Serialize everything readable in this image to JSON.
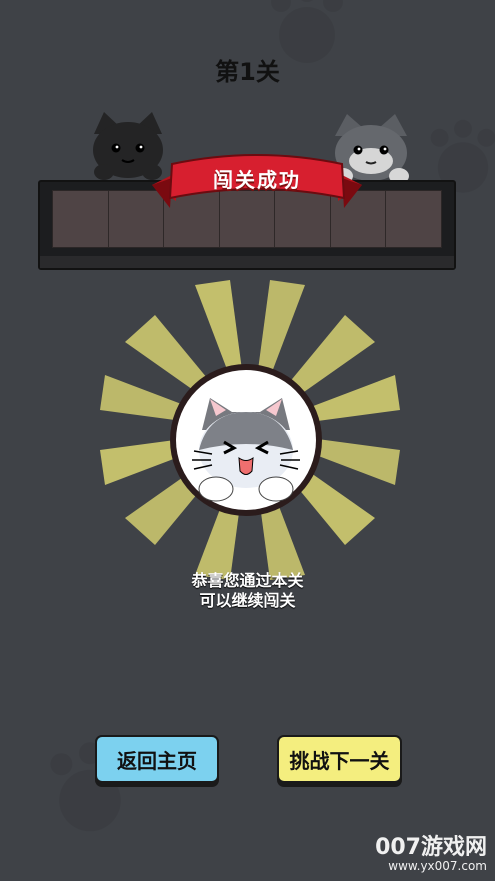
{
  "level": {
    "title": "第1关"
  },
  "banner": {
    "text": "闯关成功"
  },
  "message": {
    "line1": "恭喜您通过本关",
    "line2": "可以继续闯关"
  },
  "buttons": {
    "home": "返回主页",
    "next": "挑战下一关"
  },
  "watermark": {
    "main": "007游戏网",
    "url": "www.yx007.com"
  },
  "icons": {
    "top_left": "black-cat-icon",
    "top_right": "gray-cat-icon",
    "center": "happy-cat-icon",
    "banner": "ribbon-banner-icon"
  },
  "colors": {
    "background": "#3f4247",
    "home_button": "#7cd1ef",
    "next_button": "#f4ee7f",
    "banner_red": "#d71f2f",
    "burst_yellow": "#f7f07b"
  }
}
